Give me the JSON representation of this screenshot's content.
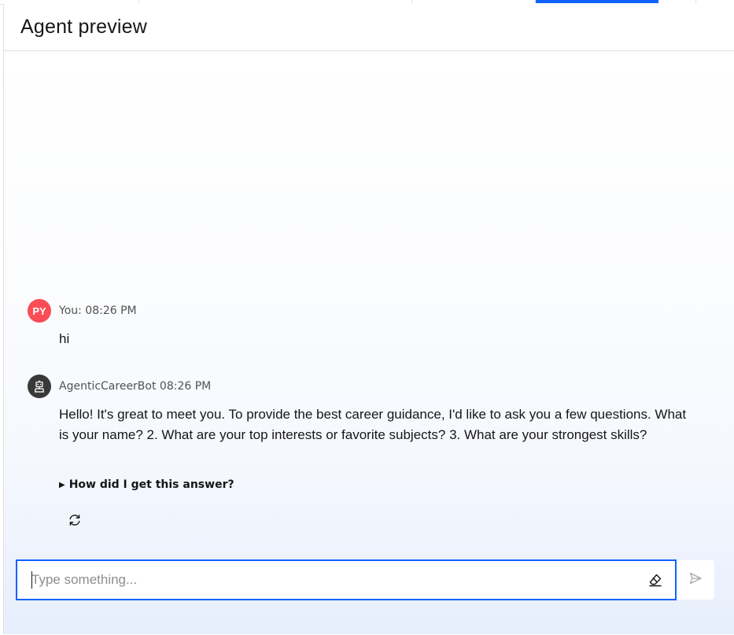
{
  "panel": {
    "title": "Agent preview"
  },
  "messages": [
    {
      "role": "user",
      "avatar_initials": "PY",
      "meta": "You: 08:26 PM",
      "text": "hi"
    },
    {
      "role": "bot",
      "avatar_icon": "robot-icon",
      "meta": "AgenticCareerBot 08:26 PM",
      "text": "Hello! It's great to meet you. To provide the best career guidance, I'd like to ask you a few questions. What is your name? 2. What are your top interests or favorite subjects? 3. What are your strongest skills?",
      "disclosure_label": "How did I get this answer?",
      "action_icon": "regenerate-icon"
    }
  ],
  "composer": {
    "placeholder": "Type something...",
    "value": "",
    "clear_icon": "eraser-icon",
    "send_icon": "send-icon"
  },
  "colors": {
    "accent": "#0f62fe",
    "user_avatar": "#fa4d56",
    "bot_avatar": "#393939"
  }
}
